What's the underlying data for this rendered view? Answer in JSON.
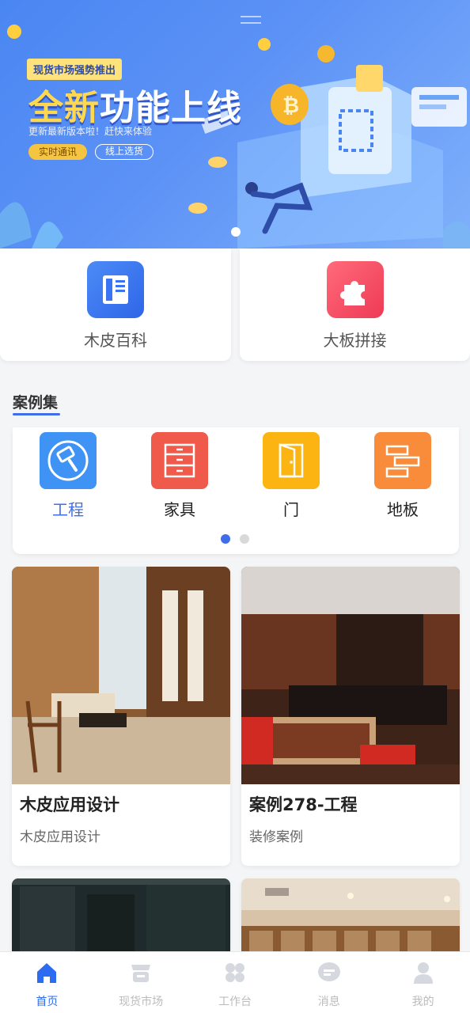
{
  "banner": {
    "tag": "现货市场强势推出",
    "headline_accent": "全新",
    "headline_rest": "功能上线",
    "subtitle": "更新最新版本啦！赶快来体验",
    "button_primary": "实时通讯",
    "button_secondary": "线上选货"
  },
  "quick_entries": [
    {
      "label": "木皮百科",
      "icon": "book-icon",
      "color": "#3a74f2"
    },
    {
      "label": "大板拼接",
      "icon": "puzzle-icon",
      "color": "#f2455c"
    }
  ],
  "section": {
    "title": "案例集"
  },
  "categories": [
    {
      "label": "工程",
      "icon": "paint-roller-icon",
      "color": "#3f93f5"
    },
    {
      "label": "家具",
      "icon": "cabinet-icon",
      "color": "#f05a4a"
    },
    {
      "label": "门",
      "icon": "door-icon",
      "color": "#fbb412"
    },
    {
      "label": "地板",
      "icon": "floor-icon",
      "color": "#f98c3a"
    }
  ],
  "cases": [
    {
      "title": "木皮应用设计",
      "subtitle": "木皮应用设计"
    },
    {
      "title": "案例278-工程",
      "subtitle": "装修案例"
    }
  ],
  "tabbar": [
    {
      "label": "首页",
      "icon": "home-icon"
    },
    {
      "label": "现货市场",
      "icon": "market-icon"
    },
    {
      "label": "工作台",
      "icon": "workbench-icon"
    },
    {
      "label": "消息",
      "icon": "message-icon"
    },
    {
      "label": "我的",
      "icon": "profile-icon"
    }
  ],
  "colors": {
    "accent": "#3f6ee8",
    "tab_active": "#2d6cf0"
  }
}
